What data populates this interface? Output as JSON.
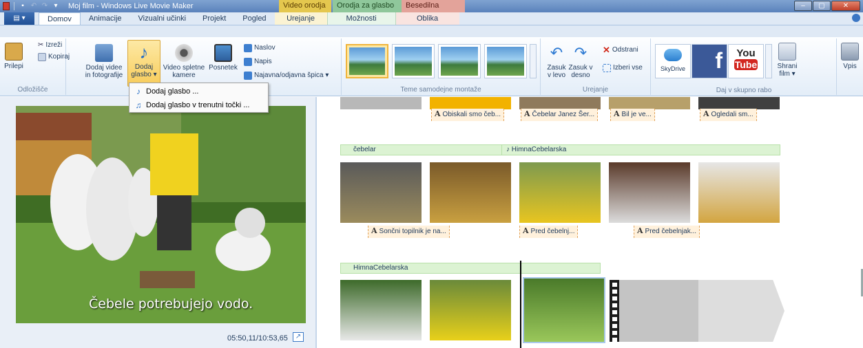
{
  "titlebar": {
    "title": "Moj film - Windows Live Movie Maker",
    "context_video": "Video orodja",
    "context_music": "Orodja za glasbo",
    "context_text": "Besedilna orodja"
  },
  "tabs": {
    "file": "▤ ▾",
    "items": [
      "Domov",
      "Animacije",
      "Vizualni učinki",
      "Projekt",
      "Pogled",
      "Urejanje",
      "Možnosti",
      "Oblika"
    ]
  },
  "ribbon": {
    "clipboard": {
      "paste": "Prilepi",
      "cut": "Izreži",
      "copy": "Kopiraj",
      "group": "Odložišče"
    },
    "add": {
      "add_video_1": "Dodaj videe",
      "add_video_2": "in fotografije",
      "add_music_1": "Dodaj",
      "add_music_2": "glasbo ▾",
      "webcam_1": "Video spletne",
      "webcam_2": "kamere",
      "snapshot": "Posnetek",
      "title": "Naslov",
      "caption": "Napis",
      "credits": "Najavna/odjavna špica ▾"
    },
    "themes": {
      "group": "Teme samodejne montaže"
    },
    "editing": {
      "rotate_left_1": "Zasuk",
      "rotate_left_2": "v levo",
      "rotate_right_1": "Zasuk v",
      "rotate_right_2": "desno",
      "remove": "Odstrani",
      "select_all": "Izberi vse",
      "group": "Urejanje"
    },
    "share": {
      "skydrive": "SkyDrive",
      "youtube_1": "You",
      "youtube_2": "Tube",
      "save_movie_1": "Shrani",
      "save_movie_2": "film ▾",
      "signin": "Vpis",
      "group": "Daj v skupno rabo"
    }
  },
  "menu": {
    "items": [
      "Dodaj glasbo ...",
      "Dodaj glasbo v trenutni točki ..."
    ]
  },
  "preview": {
    "caption": "Čebele potrebujejo vodo.",
    "time": "05:50,11/10:53,65"
  },
  "storyboard": {
    "row1_tags": [
      "Obiskali smo čeb...",
      "Čebelar Janez Šer...",
      "Bil je ve...",
      "Ogledali sm..."
    ],
    "row2_music_a": "čebelar",
    "row2_music_b": "HimnaCebelarska",
    "row2_tags": [
      "Sončni topilnik je na...",
      "Pred čebelnj...",
      "Pred čebelnjak..."
    ],
    "row3_music": "HimnaCebelarska"
  },
  "colors": {
    "ribbon_bg": "#dfe9f5",
    "highlight": "#f8cc5a",
    "music_track": "#dcf3d3",
    "text_overlay": "#fff1dc"
  }
}
